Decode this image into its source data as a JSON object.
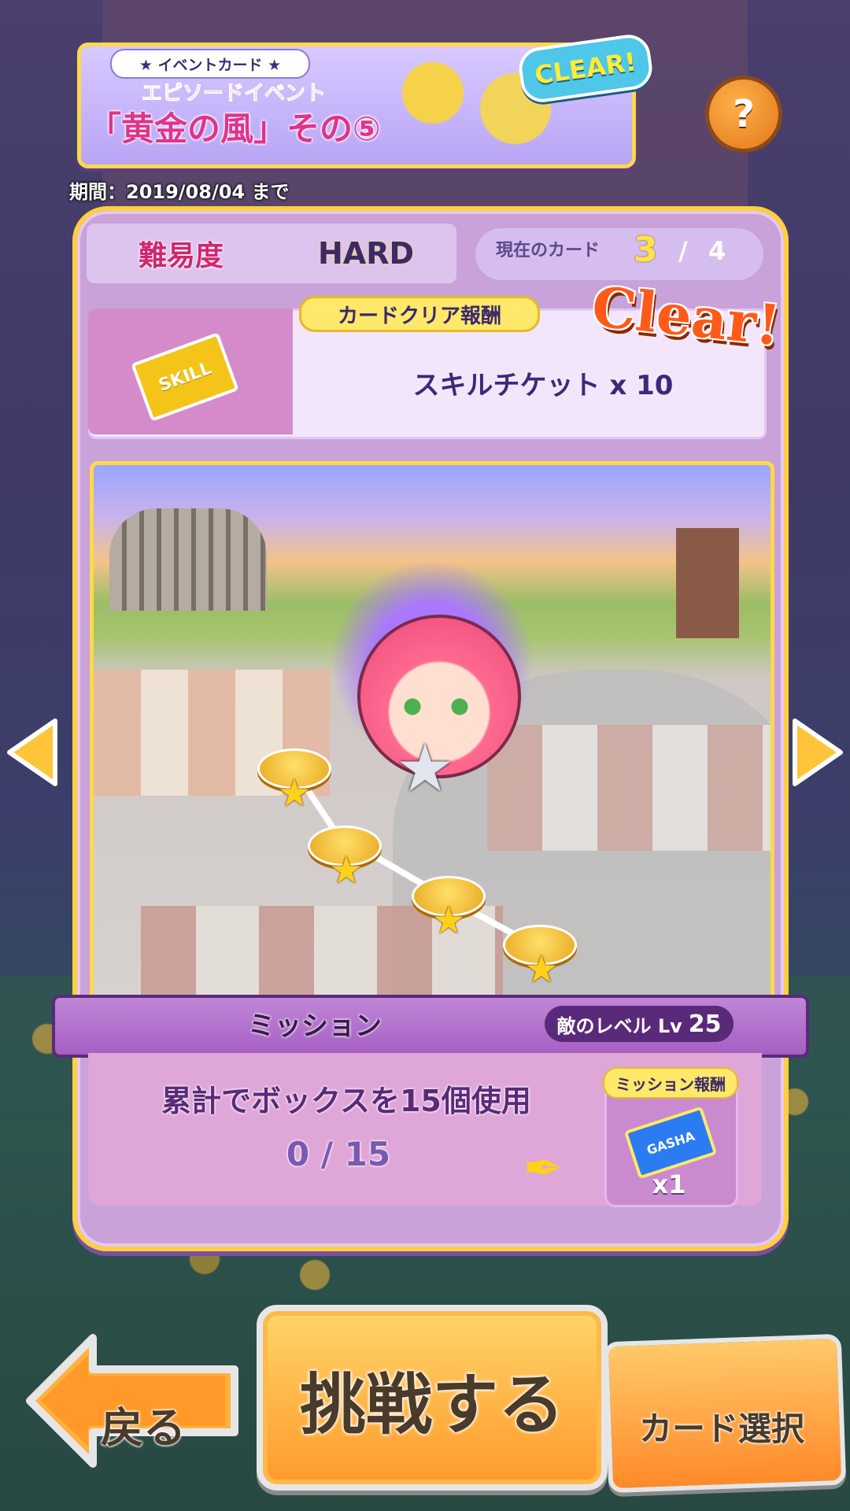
{
  "banner": {
    "tag": "★ イベントカード ★",
    "subtitle": "エピソードイベント",
    "title": "「黄金の風」その⑤",
    "clear_badge": "CLEAR!"
  },
  "help_icon": "?",
  "period": "期間：2019/08/04 まで",
  "difficulty": {
    "label": "難易度",
    "value": "HARD"
  },
  "card_progress": {
    "label": "現在のカード",
    "current": "3",
    "separator": "/",
    "total": "4"
  },
  "reward": {
    "title": "カードクリア報酬",
    "ticket_label": "SKILL",
    "text": "スキルチケット x 10",
    "clear_stamp": "Clear!"
  },
  "map": {
    "nodes_cleared": 4
  },
  "mission": {
    "label": "ミッション",
    "enemy_level_label": "敵のレベル Lv",
    "enemy_level": "25",
    "text": "累計でボックスを15個使用",
    "progress": "0 / 15",
    "reward_title": "ミッション報酬",
    "reward_ticket": "GASHA",
    "reward_count": "x1"
  },
  "buttons": {
    "back": "戻る",
    "challenge": "挑戦する",
    "card_select": "カード選択"
  },
  "colors": {
    "accent": "#ffcf3e",
    "panel": "#c8a2d9",
    "button": "#ff9a2a"
  }
}
